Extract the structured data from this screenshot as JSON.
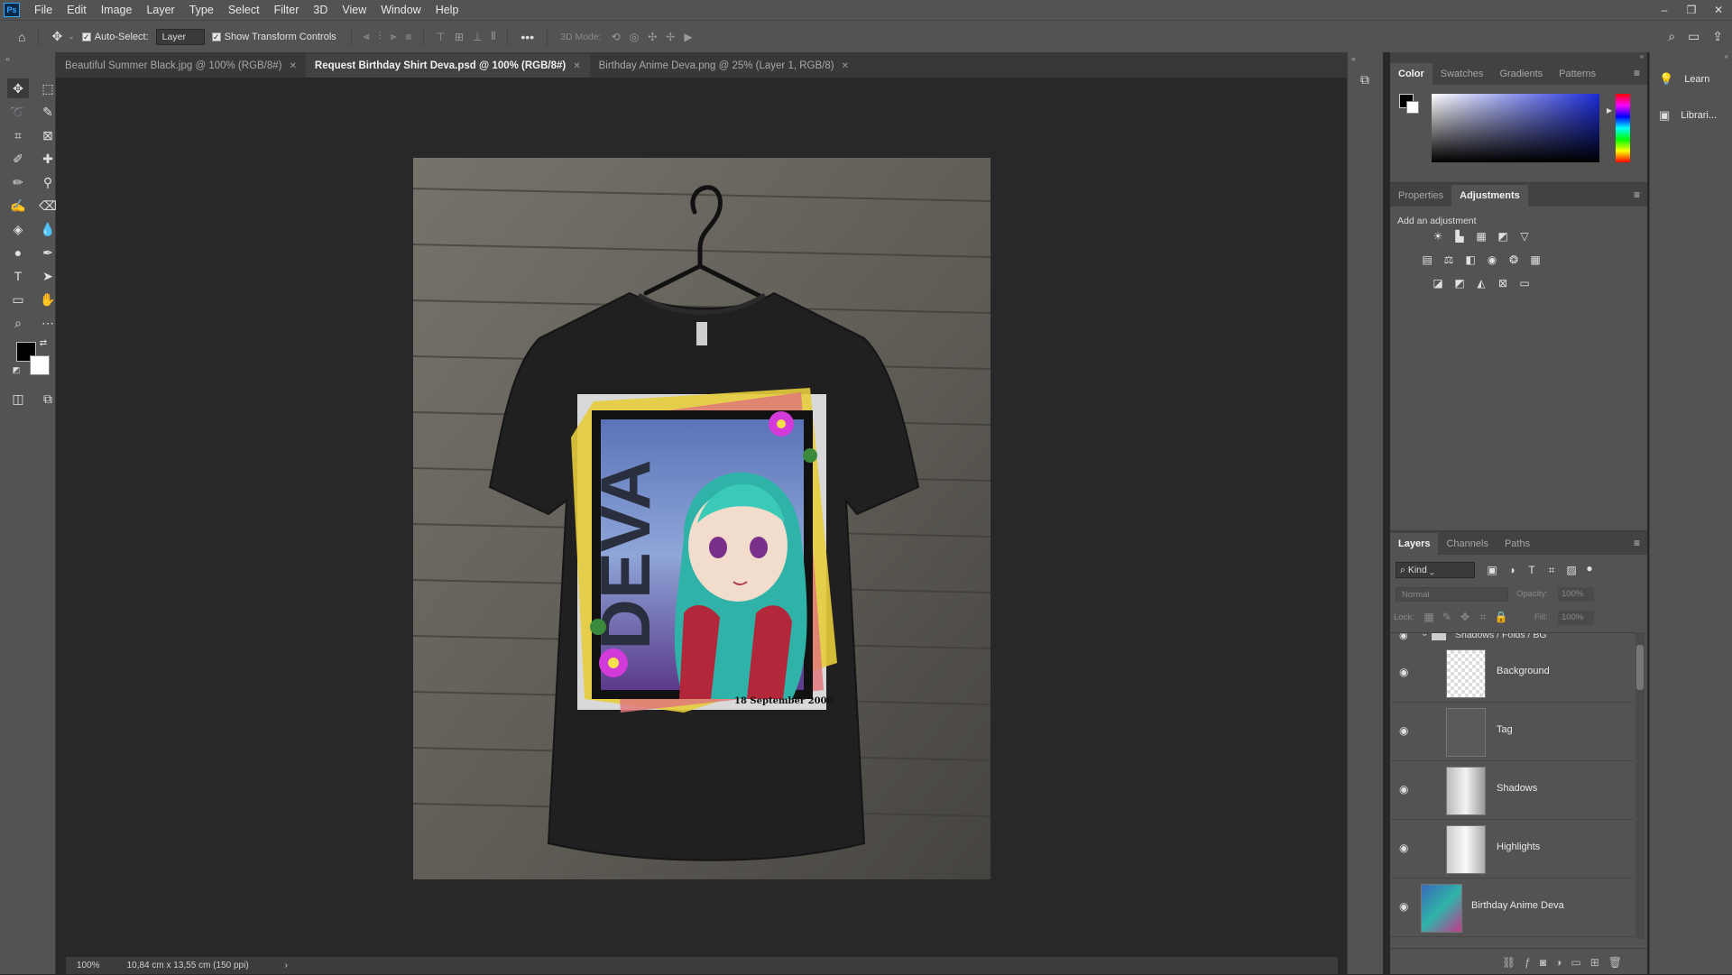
{
  "app": {
    "logo": "Ps",
    "menus": [
      "File",
      "Edit",
      "Image",
      "Layer",
      "Type",
      "Select",
      "Filter",
      "3D",
      "View",
      "Window",
      "Help"
    ]
  },
  "options": {
    "auto_select_label": "Auto-Select:",
    "auto_select_value": "Layer",
    "show_transform_label": "Show Transform Controls",
    "mode_3d_label": "3D Mode:"
  },
  "tabs": [
    {
      "label": "Beautiful Summer Black.jpg @ 100% (RGB/8#)",
      "active": false
    },
    {
      "label": "Request Birthday Shirt Deva.psd @ 100% (RGB/8#)",
      "active": true
    },
    {
      "label": "Birthday Anime Deva.png @ 25% (Layer 1, RGB/8)",
      "active": false
    }
  ],
  "artwork": {
    "title_text": "DEVA",
    "date_text": "18 September 2000"
  },
  "status": {
    "zoom": "100%",
    "doc_size": "10,84 cm x 13,55 cm (150 ppi)"
  },
  "color_panel": {
    "tabs": [
      "Color",
      "Swatches",
      "Gradients",
      "Patterns"
    ],
    "active_tab": "Color"
  },
  "adjust_panel": {
    "tabs": [
      "Properties",
      "Adjustments"
    ],
    "active_tab": "Adjustments",
    "hint": "Add an adjustment"
  },
  "layers_panel": {
    "tabs": [
      "Layers",
      "Channels",
      "Paths"
    ],
    "active_tab": "Layers",
    "filter_kind": "Kind",
    "blend_mode": "Normal",
    "opacity_label": "Opacity:",
    "opacity_value": "100%",
    "lock_label": "Lock:",
    "fill_label": "Fill:",
    "fill_value": "100%",
    "group_name": "Shadows / Folds / BG",
    "layers": [
      {
        "name": "Background"
      },
      {
        "name": "Tag"
      },
      {
        "name": "Shadows"
      },
      {
        "name": "Highlights"
      },
      {
        "name": "Birthday Anime Deva"
      }
    ]
  },
  "learn_strip": {
    "items": [
      "Learn",
      "Librari..."
    ]
  },
  "colors": {
    "chrome": "#535353",
    "canvas_bg": "#282828",
    "accent": "#31a8ff"
  }
}
